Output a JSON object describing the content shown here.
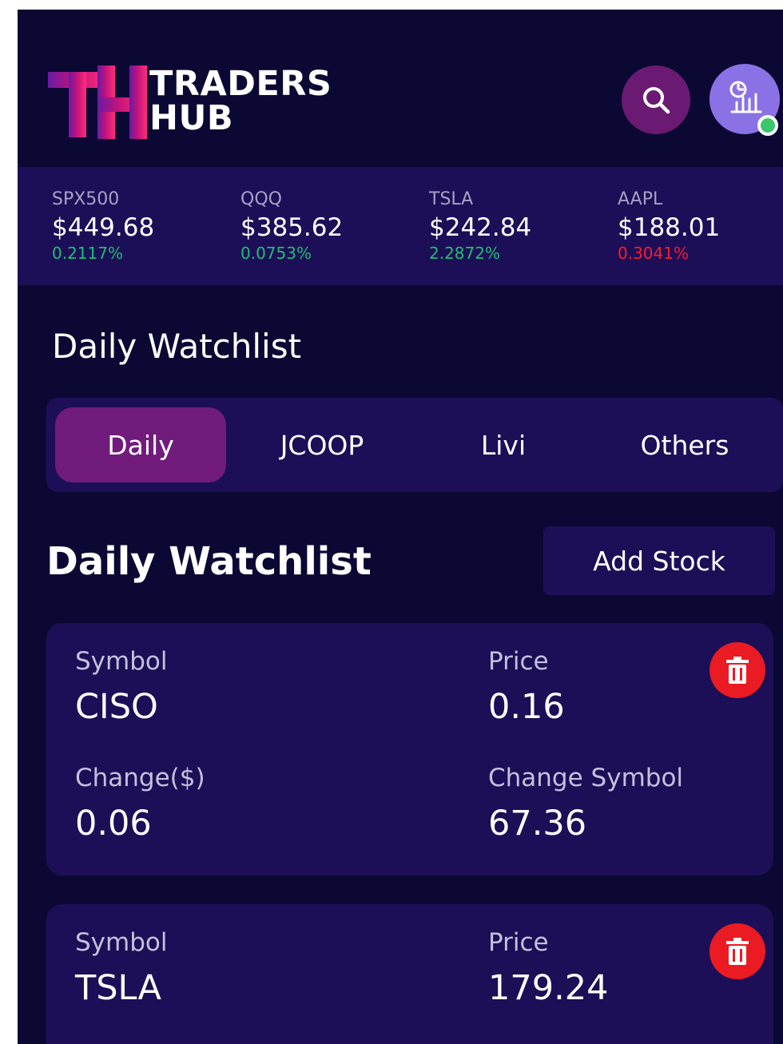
{
  "header": {
    "logo_monogram": "TH",
    "logo_line1": "TRADERS",
    "logo_line2": "HUB",
    "search_icon": "search-icon",
    "avatar_icon": "chart-avatar-icon",
    "status_color": "#3ac66a"
  },
  "ticker": [
    {
      "symbol": "SPX500",
      "price": "$449.68",
      "change": "0.2117%",
      "color": "#1fbf74"
    },
    {
      "symbol": "QQQ",
      "price": "$385.62",
      "change": "0.0753%",
      "color": "#1fbf74"
    },
    {
      "symbol": "TSLA",
      "price": "$242.84",
      "change": "2.2872%",
      "color": "#1fbf74"
    },
    {
      "symbol": "AAPL",
      "price": "$188.01",
      "change": "0.3041%",
      "color": "#ff1a2e"
    }
  ],
  "section_title": "Daily Watchlist",
  "tabs": [
    {
      "label": "Daily",
      "active": true
    },
    {
      "label": "JCOOP",
      "active": false
    },
    {
      "label": "Livi",
      "active": false
    },
    {
      "label": "Others",
      "active": false
    }
  ],
  "list": {
    "title": "Daily Watchlist",
    "add_label": "Add Stock"
  },
  "stocks": [
    {
      "symbol_label": "Symbol",
      "symbol": "CISO",
      "price_label": "Price",
      "price": "0.16",
      "change_label": "Change($)",
      "change": "0.06",
      "change_symbol_label": "Change Symbol",
      "change_symbol": "67.36",
      "delete_icon": "trash-icon"
    },
    {
      "symbol_label": "Symbol",
      "symbol": "TSLA",
      "price_label": "Price",
      "price": "179.24",
      "delete_icon": "trash-icon"
    }
  ],
  "colors": {
    "background": "#0b0933",
    "panel": "#1c0f57",
    "accent": "#711b7c",
    "positive": "#1fbf74",
    "negative": "#ff1a2e",
    "delete": "#ea1b23"
  }
}
